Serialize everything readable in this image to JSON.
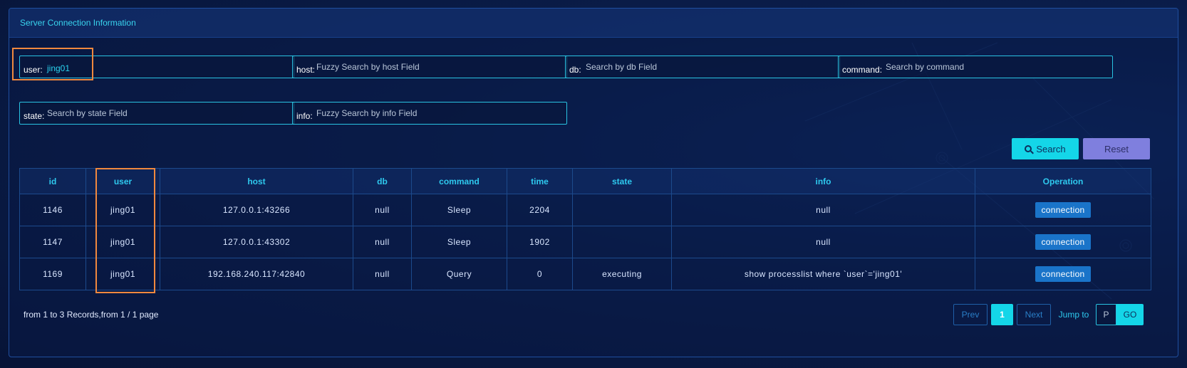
{
  "panel": {
    "title": "Server Connection Information"
  },
  "filters": {
    "user": {
      "label": "user:",
      "value": "jing01"
    },
    "host": {
      "label": "host:",
      "placeholder": "Fuzzy Search by host Field"
    },
    "db": {
      "label": "db:",
      "placeholder": "Search by db Field"
    },
    "command": {
      "label": "command:",
      "placeholder": "Search by command"
    },
    "state": {
      "label": "state:",
      "placeholder": "Search by state Field"
    },
    "info": {
      "label": "info:",
      "placeholder": "Fuzzy Search by info Field"
    }
  },
  "buttons": {
    "search": "Search",
    "reset": "Reset"
  },
  "table": {
    "columns": [
      "id",
      "user",
      "host",
      "db",
      "command",
      "time",
      "state",
      "info",
      "Operation"
    ],
    "rows": [
      {
        "id": "1146",
        "user": "jing01",
        "host": "127.0.0.1:43266",
        "db": "null",
        "command": "Sleep",
        "time": "2204",
        "state": "",
        "info": "null",
        "operation": "connection"
      },
      {
        "id": "1147",
        "user": "jing01",
        "host": "127.0.0.1:43302",
        "db": "null",
        "command": "Sleep",
        "time": "1902",
        "state": "",
        "info": "null",
        "operation": "connection"
      },
      {
        "id": "1169",
        "user": "jing01",
        "host": "192.168.240.117:42840",
        "db": "null",
        "command": "Query",
        "time": "0",
        "state": "executing",
        "info": "show processlist where `user`='jing01'",
        "operation": "connection"
      }
    ]
  },
  "pagination": {
    "summary": "from 1 to 3 Records,from 1 / 1 page",
    "prev": "Prev",
    "current": "1",
    "next": "Next",
    "jump_to": "Jump to",
    "page_input_placeholder": "P",
    "go": "GO"
  },
  "colors": {
    "accent": "#14d6e8",
    "reset": "#7f7fde",
    "highlight": "#f0883e",
    "connection_button": "#1a74c9"
  }
}
